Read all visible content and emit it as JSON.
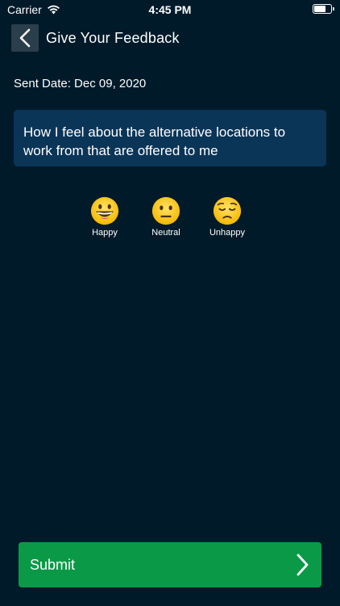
{
  "status_bar": {
    "carrier": "Carrier",
    "time": "4:45 PM",
    "battery_level": 0.75
  },
  "header": {
    "title": "Give Your Feedback",
    "back_icon": "chevron-left-icon"
  },
  "sent_date": "Sent Date: Dec 09, 2020",
  "question": "How I feel about the alternative locations to work from that are offered to me",
  "emoji_options": [
    {
      "label": "Happy",
      "icon": "grinning-face-icon"
    },
    {
      "label": "Neutral",
      "icon": "neutral-face-icon"
    },
    {
      "label": "Unhappy",
      "icon": "pensive-face-icon"
    }
  ],
  "submit": {
    "label": "Submit",
    "icon": "chevron-right-icon"
  },
  "colors": {
    "background": "#001a2a",
    "card": "#0b3557",
    "back_button": "#2b3e4c",
    "submit": "#0a9a47"
  }
}
